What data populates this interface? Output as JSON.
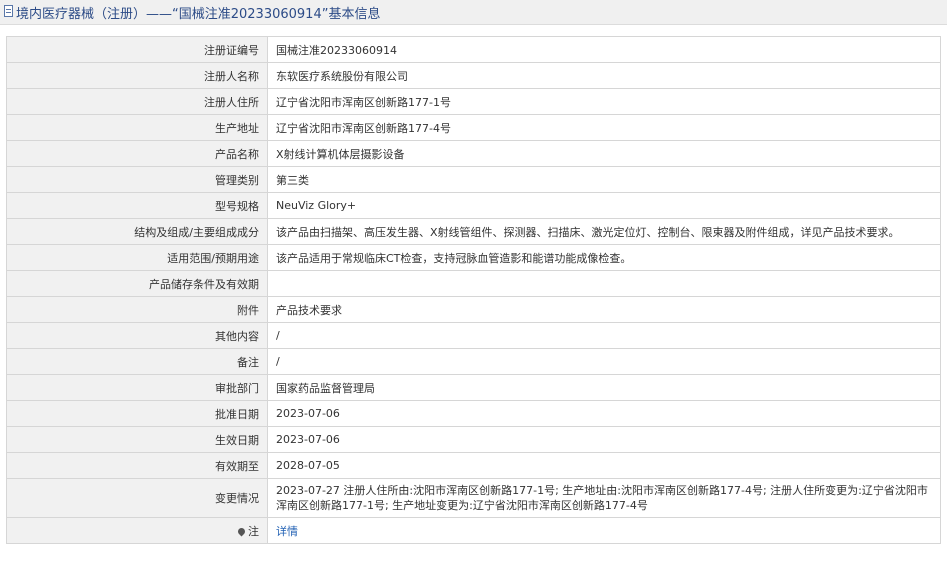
{
  "header": {
    "title": "境内医疗器械（注册）——“国械注准20233060914”基本信息"
  },
  "rows": [
    {
      "label": "注册证编号",
      "value": "国械注准20233060914"
    },
    {
      "label": "注册人名称",
      "value": "东软医疗系统股份有限公司"
    },
    {
      "label": "注册人住所",
      "value": "辽宁省沈阳市浑南区创新路177-1号"
    },
    {
      "label": "生产地址",
      "value": "辽宁省沈阳市浑南区创新路177-4号"
    },
    {
      "label": "产品名称",
      "value": "X射线计算机体层摄影设备"
    },
    {
      "label": "管理类别",
      "value": "第三类"
    },
    {
      "label": "型号规格",
      "value": "NeuViz Glory+"
    },
    {
      "label": "结构及组成/主要组成成分",
      "value": "该产品由扫描架、高压发生器、X射线管组件、探测器、扫描床、激光定位灯、控制台、限束器及附件组成，详见产品技术要求。"
    },
    {
      "label": "适用范围/预期用途",
      "value": "该产品适用于常规临床CT检查，支持冠脉血管造影和能谱功能成像检查。"
    },
    {
      "label": "产品储存条件及有效期",
      "value": ""
    },
    {
      "label": "附件",
      "value": "产品技术要求"
    },
    {
      "label": "其他内容",
      "value": "/"
    },
    {
      "label": "备注",
      "value": "/"
    },
    {
      "label": "审批部门",
      "value": "国家药品监督管理局"
    },
    {
      "label": "批准日期",
      "value": "2023-07-06"
    },
    {
      "label": "生效日期",
      "value": "2023-07-06"
    },
    {
      "label": "有效期至",
      "value": "2028-07-05"
    },
    {
      "label": "变更情况",
      "value": "2023-07-27 注册人住所由:沈阳市浑南区创新路177-1号; 生产地址由:沈阳市浑南区创新路177-4号; 注册人住所变更为:辽宁省沈阳市浑南区创新路177-1号; 生产地址变更为:辽宁省沈阳市浑南区创新路177-4号"
    }
  ],
  "note": {
    "label": "注",
    "link_text": "详情",
    "icon": "pin-icon"
  }
}
